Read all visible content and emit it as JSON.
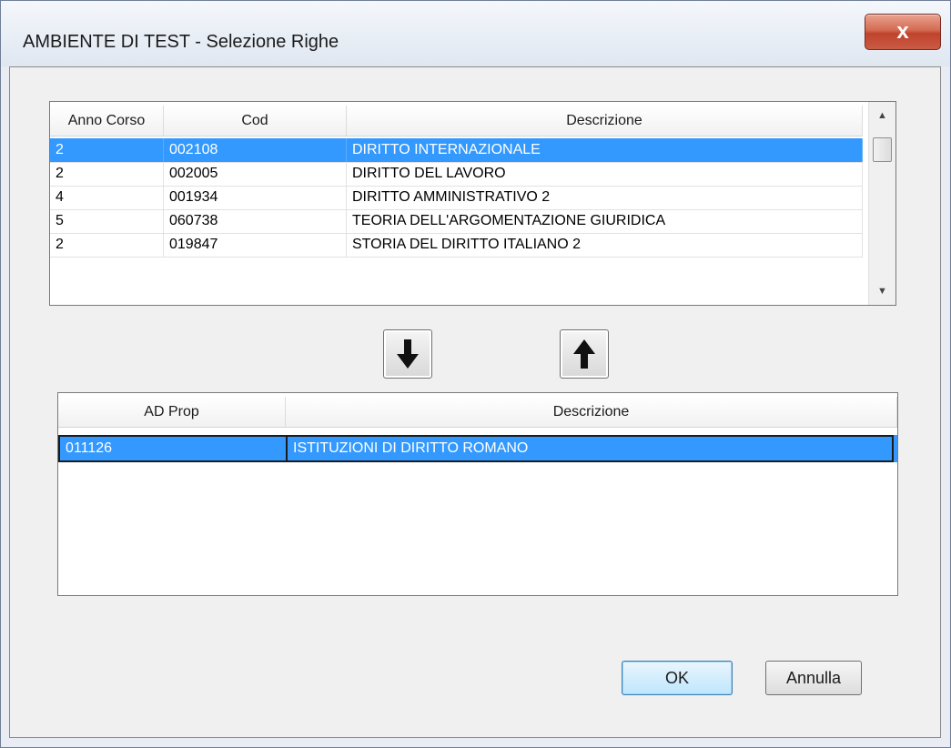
{
  "window": {
    "title": "AMBIENTE DI TEST - Selezione Righe",
    "close_label": "x"
  },
  "top_grid": {
    "columns": [
      "Anno Corso",
      "Cod",
      "Descrizione"
    ],
    "rows": [
      {
        "anno": "2",
        "cod": "002108",
        "descrizione": "DIRITTO INTERNAZIONALE",
        "selected": true
      },
      {
        "anno": "2",
        "cod": "002005",
        "descrizione": "DIRITTO DEL LAVORO",
        "selected": false
      },
      {
        "anno": "4",
        "cod": "001934",
        "descrizione": "DIRITTO AMMINISTRATIVO 2",
        "selected": false
      },
      {
        "anno": "5",
        "cod": "060738",
        "descrizione": "TEORIA DELL'ARGOMENTAZIONE GIURIDICA",
        "selected": false
      },
      {
        "anno": "2",
        "cod": "019847",
        "descrizione": "STORIA DEL DIRITTO ITALIANO 2",
        "selected": false
      }
    ]
  },
  "move_buttons": {
    "down_icon": "arrow-down-icon",
    "up_icon": "arrow-up-icon"
  },
  "bottom_grid": {
    "columns": [
      "AD Prop",
      "Descrizione"
    ],
    "rows": [
      {
        "ad_prop": "011126",
        "descrizione": "ISTITUZIONI DI DIRITTO ROMANO",
        "selected": true
      }
    ]
  },
  "buttons": {
    "ok": "OK",
    "cancel": "Annulla"
  },
  "colors": {
    "selection": "#3399ff",
    "close_button": "#c95b45"
  }
}
